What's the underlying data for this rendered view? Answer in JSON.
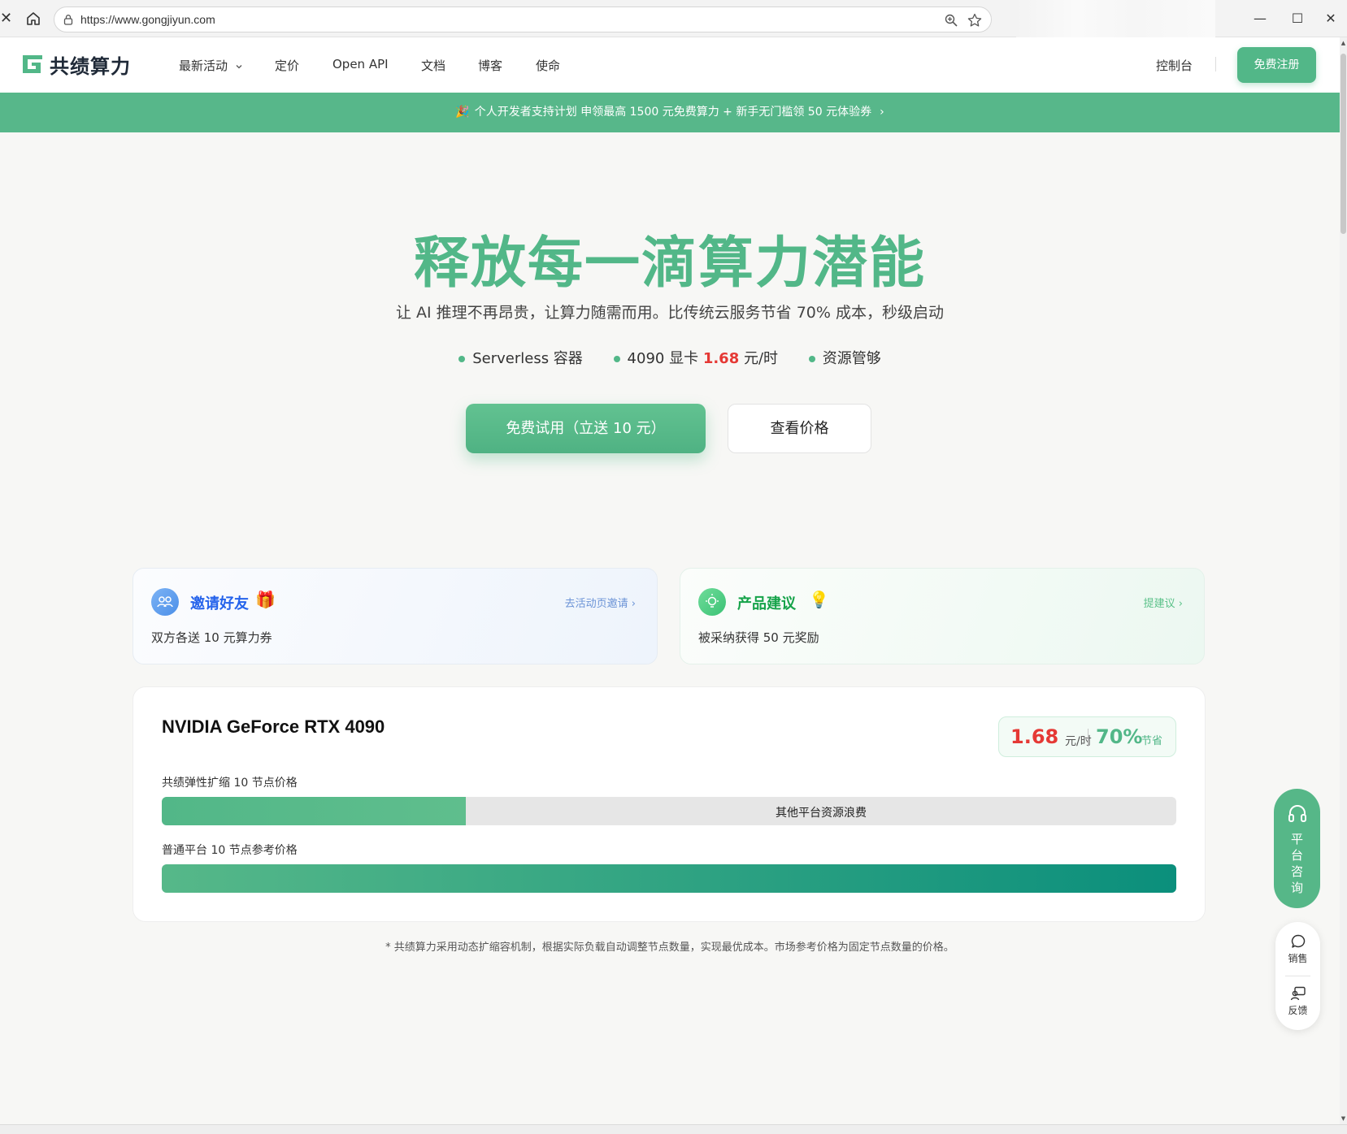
{
  "browser": {
    "url": "https://www.gongjiyun.com",
    "close_glyph": "✕",
    "minimize_glyph": "—",
    "maximize_glyph": "☐",
    "window_close_glyph": "✕"
  },
  "nav": {
    "logo_text": "共绩算力",
    "items": [
      "最新活动",
      "定价",
      "Open API",
      "文档",
      "博客",
      "使命"
    ],
    "console": "控制台",
    "register": "免费注册"
  },
  "promo": {
    "emoji": "🎉",
    "text": "个人开发者支持计划  申领最高 1500 元免费算力 + 新手无门槛领 50 元体验券",
    "arrow": "›"
  },
  "hero": {
    "title": "释放每一滴算力潜能",
    "subtitle": "让 AI 推理不再昂贵，让算力随需而用。比传统云服务节省 70% 成本，秒级启动",
    "features": {
      "f1": "Serverless 容器",
      "f2_prefix": "4090 显卡 ",
      "f2_price": "1.68",
      "f2_suffix": " 元/时",
      "f3": "资源管够"
    },
    "btn_trial": "免费试用（立送 10 元）",
    "btn_price": "查看价格"
  },
  "cards": {
    "invite": {
      "title": "邀请好友",
      "deco": "🎁",
      "link": "去活动页邀请 ›",
      "desc": "双方各送 10 元算力券"
    },
    "suggest": {
      "title": "产品建议",
      "deco": "💡",
      "link": "提建议 ›",
      "desc": "被采纳获得 50 元奖励"
    }
  },
  "gpu": {
    "name": "NVIDIA GeForce RTX 4090",
    "price": "1.68",
    "price_unit": "元/时",
    "saving": "70%",
    "saving_unit": "节省",
    "bar1_label": "共绩弹性扩缩 10 节点价格",
    "bar1_fraction": 0.3,
    "bar1_waste_label": "其他平台资源浪费",
    "bar2_label": "普通平台 10 节点参考价格",
    "bar2_fraction": 1.0,
    "accent_color": "#52b788",
    "price_color": "#e53935"
  },
  "footnote": "* 共绩算力采用动态扩缩容机制，根据实际负载自动调整节点数量，实现最优成本。市场参考价格为固定节点数量的价格。",
  "float": {
    "consult": "平\n台\n咨\n询",
    "sales": "销售",
    "feedback": "反馈"
  },
  "icons": {
    "home": "home-icon",
    "lock": "lock-icon",
    "zoom": "zoom-icon",
    "star": "star-icon",
    "headphones": "headphones-icon",
    "chat": "chat-bubble-icon",
    "feedback": "feedback-icon"
  }
}
